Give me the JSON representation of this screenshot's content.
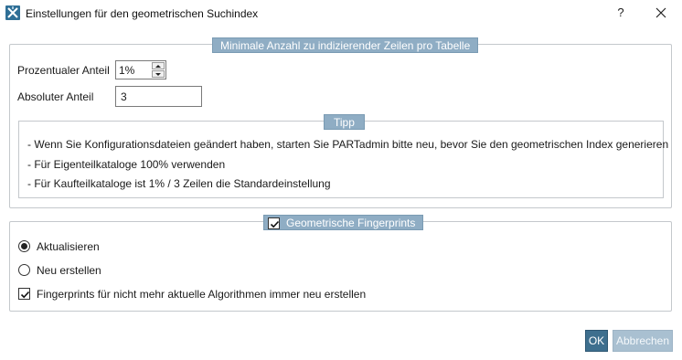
{
  "window": {
    "title": "Einstellungen für den geometrischen Suchindex",
    "help_label": "?"
  },
  "min_rows_group": {
    "legend": "Minimale Anzahl zu indizierender Zeilen pro Tabelle",
    "percent_label": "Prozentualer Anteil",
    "percent_value": "1%",
    "absolute_label": "Absoluter Anteil",
    "absolute_value": "3"
  },
  "tip": {
    "legend": "Tipp",
    "lines": [
      "- Wenn Sie Konfigurationsdateien geändert haben, starten Sie PARTadmin bitte neu, bevor Sie den geometrischen Index generieren",
      "- Für Eigenteilkataloge 100% verwenden",
      "- Für Kaufteilkataloge ist 1% / 3 Zeilen die Standardeinstellung"
    ]
  },
  "fingerprints_group": {
    "legend": "Geometrische Fingerprints",
    "enabled": true,
    "options": [
      {
        "label": "Aktualisieren",
        "selected": true
      },
      {
        "label": "Neu erstellen",
        "selected": false
      }
    ],
    "rebuild_outdated_label": "Fingerprints für nicht mehr aktuelle Algorithmen immer neu erstellen",
    "rebuild_outdated_checked": true
  },
  "buttons": {
    "ok_label": "OK",
    "cancel_label": "Abbrechen"
  },
  "colors": {
    "legend_bg": "#8fadc4",
    "ok_bg": "#3e6f8e",
    "cancel_bg": "#a9c0d1",
    "app_icon": "#2f6f96"
  },
  "icons": {
    "app": "app-icon",
    "close": "close-icon",
    "spin_up": "chevron-up-icon",
    "spin_down": "chevron-down-icon",
    "check": "check-icon"
  }
}
